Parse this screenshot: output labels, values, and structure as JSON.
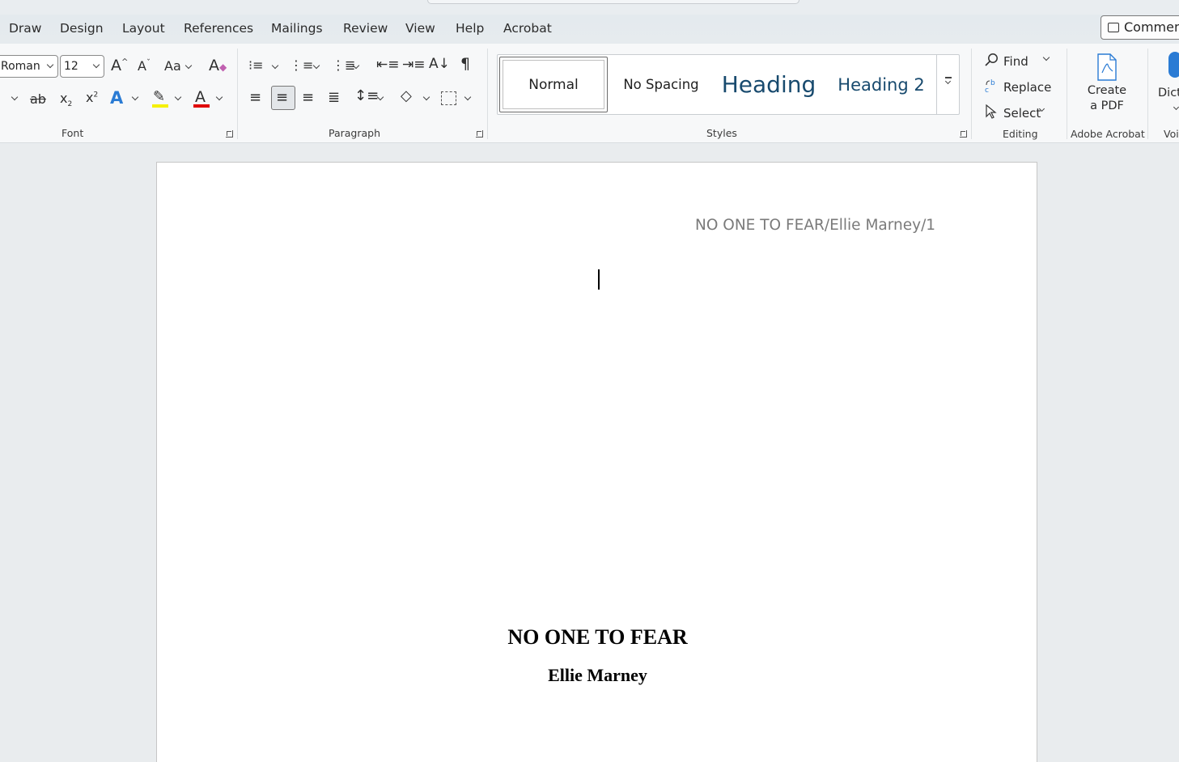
{
  "tabs": [
    "Draw",
    "Design",
    "Layout",
    "References",
    "Mailings",
    "Review",
    "View",
    "Help",
    "Acrobat"
  ],
  "comments_label": "Comments",
  "font": {
    "name": "Roman",
    "size": "12",
    "group_label": "Font"
  },
  "paragraph": {
    "group_label": "Paragraph"
  },
  "styles": {
    "items": [
      "Normal",
      "No Spacing",
      "Heading",
      "Heading 2"
    ],
    "group_label": "Styles"
  },
  "editing": {
    "find": "Find",
    "replace": "Replace",
    "select": "Select",
    "group_label": "Editing"
  },
  "acrobat": {
    "create_pdf": "Create a PDF",
    "group_label": "Adobe Acrobat"
  },
  "voice": {
    "dictate": "Dict",
    "group_label": "Voi"
  },
  "document": {
    "header": "NO ONE TO FEAR/Ellie Marney/1",
    "title": "NO ONE TO FEAR",
    "author": "Ellie Marney"
  },
  "colors": {
    "highlight": "#f5f000",
    "font_color": "#e00000",
    "text_effect": "#2a7bd4",
    "heading": "#184a6e"
  }
}
